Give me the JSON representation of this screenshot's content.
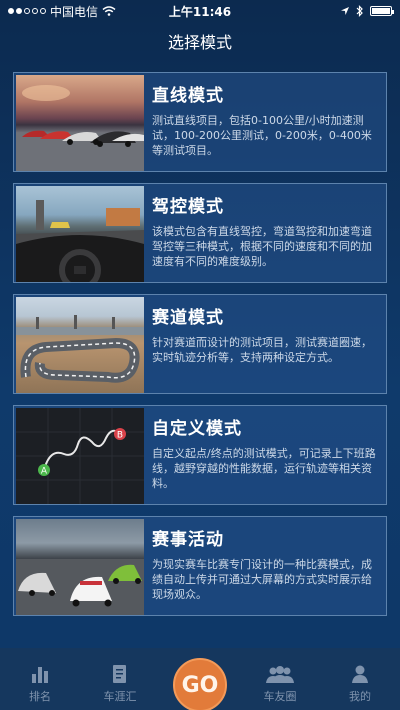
{
  "status_bar": {
    "carrier": "中国电信",
    "time": "上午11:46"
  },
  "header": {
    "title": "选择模式"
  },
  "modes": [
    {
      "title": "直线模式",
      "description": "测试直线项目，包括0-100公里/小时加速测试，100-200公里测试，0-200米，0-400米等测试项目。"
    },
    {
      "title": "驾控模式",
      "description": "该模式包含有直线驾控，弯道驾控和加速弯道驾控等三种模式，根据不同的速度和不同的加速度有不同的难度级别。"
    },
    {
      "title": "赛道模式",
      "description": "针对赛道而设计的测试项目，测试赛道圈速，实时轨迹分析等，支持两种设定方式。"
    },
    {
      "title": "自定义模式",
      "description": "自定义起点/终点的测试模式，可记录上下班路线，越野穿越的性能数据，运行轨迹等相关资料。"
    },
    {
      "title": "赛事活动",
      "description": "为现实赛车比赛专门设计的一种比赛模式，成绩自动上传并可通过大屏幕的方式实时展示给现场观众。"
    }
  ],
  "custom_thumb": {
    "start_marker": "A",
    "end_marker": "B"
  },
  "tab_bar": {
    "ranking": "排名",
    "car_club": "车涯汇",
    "go": "GO",
    "friends": "车友圈",
    "mine": "我的"
  },
  "colors": {
    "go_button": "#e27b3a",
    "tab_inactive": "#7f93ad",
    "card_border": "#5d83ad"
  }
}
